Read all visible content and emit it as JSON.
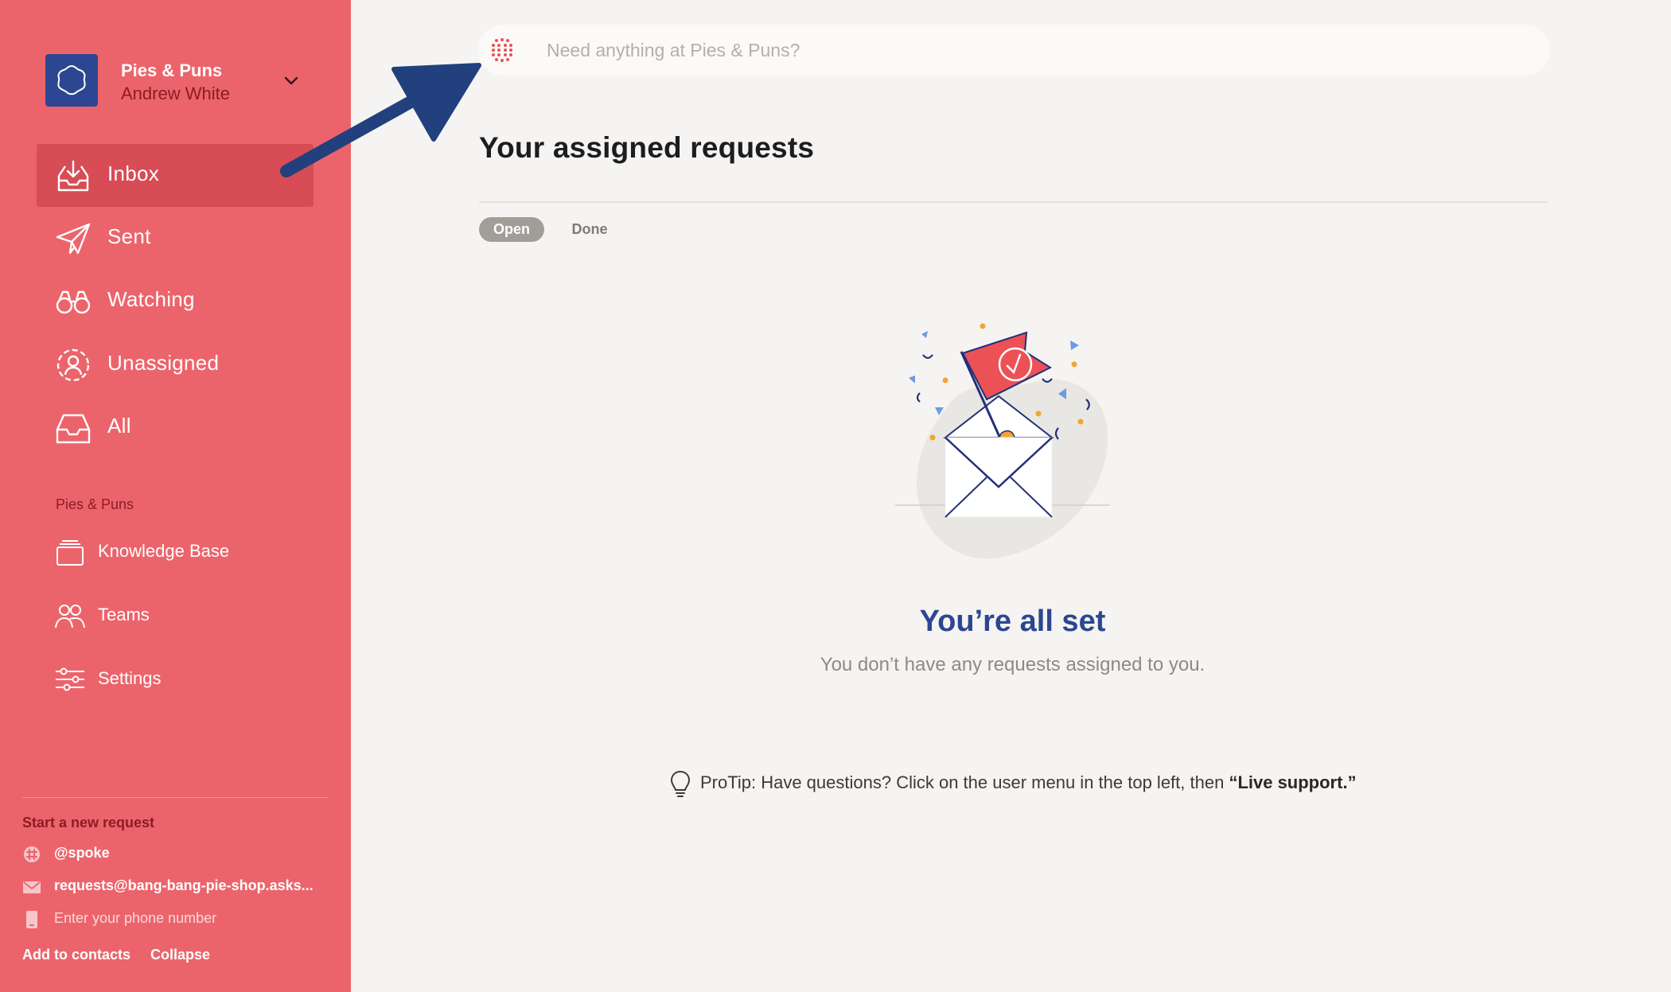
{
  "org": {
    "name": "Pies & Puns",
    "user": "Andrew White"
  },
  "nav": [
    {
      "label": "Inbox",
      "icon": "inbox-icon",
      "active": true
    },
    {
      "label": "Sent",
      "icon": "paper-plane-icon"
    },
    {
      "label": "Watching",
      "icon": "binoculars-icon"
    },
    {
      "label": "Unassigned",
      "icon": "unassigned-user-icon"
    },
    {
      "label": "All",
      "icon": "tray-icon"
    }
  ],
  "section": {
    "label": "Pies & Puns",
    "items": [
      {
        "label": "Knowledge Base",
        "icon": "knowledge-base-icon"
      },
      {
        "label": "Teams",
        "icon": "teams-icon"
      },
      {
        "label": "Settings",
        "icon": "settings-sliders-icon"
      }
    ]
  },
  "footer": {
    "title": "Start a new request",
    "slack": "@spoke",
    "email": "requests@bang-bang-pie-shop.asks...",
    "phone_placeholder": "Enter your phone number",
    "add_to_contacts": "Add to contacts",
    "collapse": "Collapse"
  },
  "search": {
    "placeholder": "Need anything at Pies & Puns?"
  },
  "main": {
    "title": "Your assigned requests",
    "tabs": {
      "open": "Open",
      "done": "Done"
    },
    "empty_title": "You’re all set",
    "empty_desc": "You don’t have any requests assigned to you.",
    "protip_prefix": "ProTip: Have questions? Click on the user menu in the top left, then ",
    "protip_bold": "“Live support.”"
  },
  "colors": {
    "sidebar": "#ec646b",
    "sidebar_active": "#d74c55",
    "brand_blue": "#2d4691",
    "accent_red": "#ec5156"
  }
}
